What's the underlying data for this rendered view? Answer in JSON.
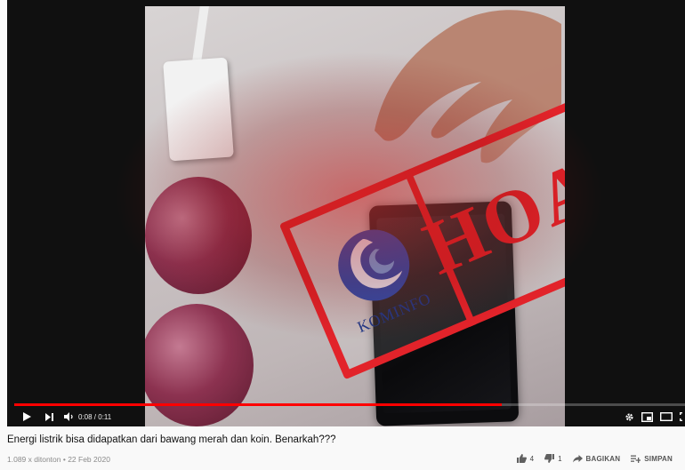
{
  "video": {
    "stamp_text": "HOAKS",
    "logo_text": "KOMINFO",
    "time_display": "0:08 / 0:11",
    "progress_fraction": 0.727
  },
  "info": {
    "title": "Energi listrik bisa didapatkan dari bawang merah dan koin. Benarkah???",
    "meta": "1.089 x ditonton • 22 Feb 2020"
  },
  "actions": {
    "like_count": "4",
    "dislike_count": "1",
    "share_label": "BAGIKAN",
    "save_label": "SIMPAN"
  },
  "icons": {
    "play": "play-icon",
    "next": "next-icon",
    "volume": "volume-icon",
    "settings": "gear-icon",
    "miniplayer": "miniplayer-icon",
    "theater": "theater-icon",
    "fullscreen": "fullscreen-icon",
    "like": "thumbs-up-icon",
    "dislike": "thumbs-down-icon",
    "share": "share-arrow-icon",
    "save": "playlist-add-icon"
  },
  "colors": {
    "stamp_red": "#e2232a",
    "progress_red": "#ff0000",
    "player_bg": "#101010"
  }
}
